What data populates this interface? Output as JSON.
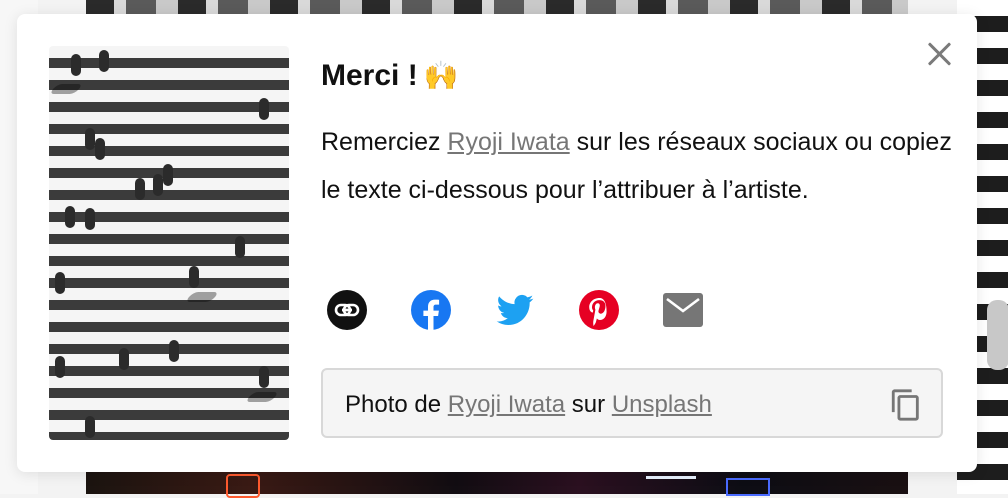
{
  "dialog": {
    "title": "Merci !",
    "title_emoji": "🙌",
    "description_before": "Remerciez ",
    "artist_name": "Ryoji Iwata",
    "description_after": " sur les réseaux sociaux ou copiez le texte ci-dessous pour l’attribuer à l’artiste.",
    "close_icon": "close-icon"
  },
  "share_buttons": [
    {
      "name": "link",
      "icon": "link-icon",
      "color": "#111111"
    },
    {
      "name": "facebook",
      "icon": "facebook-icon",
      "color": "#1877F2"
    },
    {
      "name": "twitter",
      "icon": "twitter-icon",
      "color": "#1DA1F2"
    },
    {
      "name": "pinterest",
      "icon": "pinterest-icon",
      "color": "#E60023"
    },
    {
      "name": "email",
      "icon": "mail-icon",
      "color": "#767676"
    }
  ],
  "attribution": {
    "prefix": "Photo de ",
    "artist_name": "Ryoji Iwata",
    "middle": " sur ",
    "site_name": "Unsplash",
    "copy_icon": "copy-icon"
  }
}
